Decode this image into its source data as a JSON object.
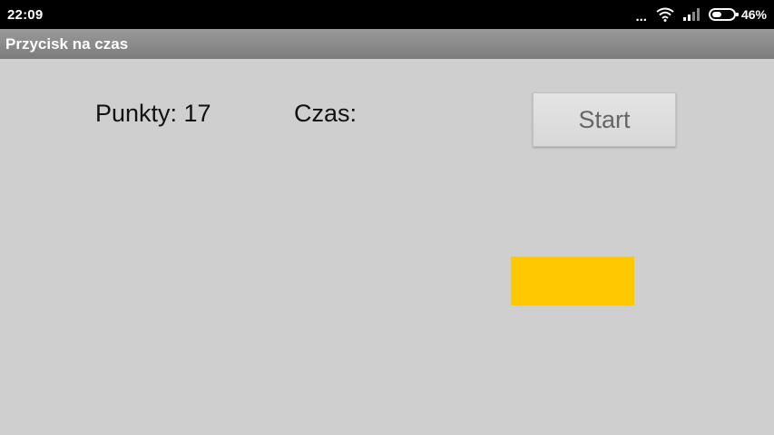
{
  "status_bar": {
    "time": "22:09",
    "dots": "...",
    "battery_percent": "46%",
    "battery_level": 0.46,
    "icons": [
      "more-dots-icon",
      "wifi-icon",
      "signal-icon",
      "battery-icon"
    ]
  },
  "action_bar": {
    "title": "Przycisk na czas"
  },
  "main": {
    "score_text": "Punkty: 17",
    "time_text": "Czas:",
    "start_label": "Start",
    "target_color": "#ffc800"
  }
}
